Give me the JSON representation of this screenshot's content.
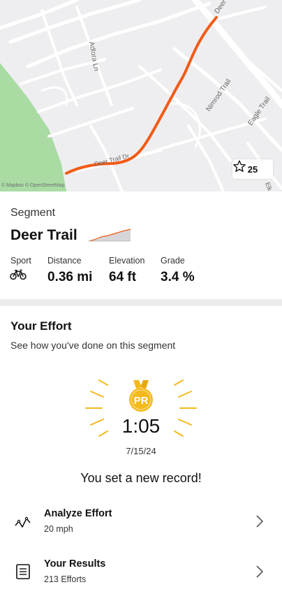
{
  "map": {
    "attribution": "© Mapbox © OpenStreetMap",
    "street_labels": [
      "Adlora Ln",
      "Nimrod Trail",
      "Eagle Trail",
      "Deer",
      "Deer Trail Dr",
      "Elk Pl"
    ],
    "star_count": "25",
    "route_color": "#f25b16",
    "park_color": "#a9dba3"
  },
  "segment": {
    "label": "Segment",
    "name": "Deer Trail",
    "stats": [
      {
        "label": "Sport",
        "value": "",
        "icon": "bike-icon"
      },
      {
        "label": "Distance",
        "value": "0.36 mi"
      },
      {
        "label": "Elevation",
        "value": "64 ft"
      },
      {
        "label": "Grade",
        "value": "3.4 %"
      }
    ]
  },
  "effort": {
    "title": "Your Effort",
    "subtitle": "See how you've done on this segment",
    "badge": "PR",
    "time": "1:05",
    "date": "7/15/24",
    "message": "You set a new record!",
    "medal_color": "#f5b91b"
  },
  "rows": [
    {
      "title": "Analyze Effort",
      "subtitle": "20 mph",
      "icon": "analyze-icon"
    },
    {
      "title": "Your Results",
      "subtitle": "213 Efforts",
      "icon": "results-list-icon"
    }
  ]
}
